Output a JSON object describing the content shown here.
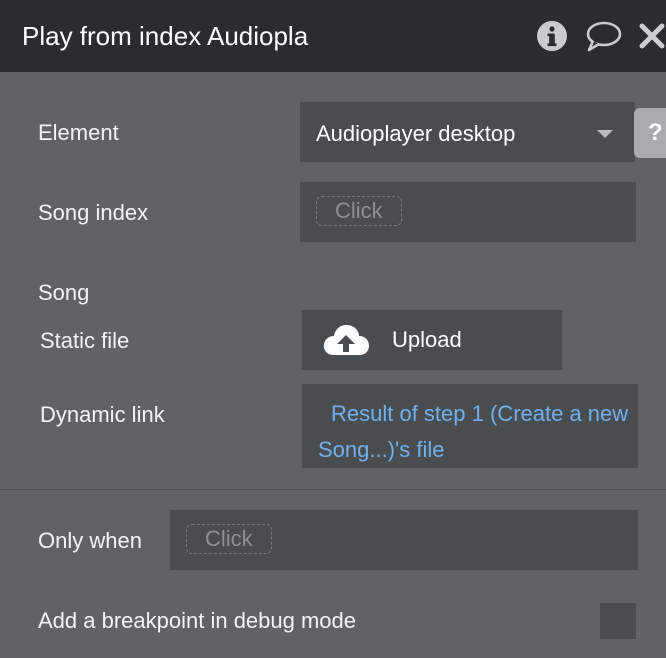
{
  "header": {
    "title": "Play from index Audiopla",
    "icons": [
      "info-icon",
      "comment-icon",
      "close-icon"
    ]
  },
  "form": {
    "element": {
      "label": "Element",
      "value": "Audioplayer desktop",
      "help": "?"
    },
    "song_index": {
      "label": "Song index",
      "placeholder": "Click"
    },
    "song": {
      "label": "Song",
      "static_file": {
        "label": "Static file",
        "button": "Upload",
        "icon": "cloud-upload-icon"
      },
      "dynamic_link": {
        "label": "Dynamic link",
        "value": "Result of step 1 (Create a new Song...)'s file"
      }
    },
    "only_when": {
      "label": "Only when",
      "placeholder": "Click"
    },
    "breakpoint": {
      "label": "Add a breakpoint in debug mode",
      "checked": false
    }
  },
  "colors": {
    "header_bg": "#2a2d30",
    "panel_bg": "#5f6367",
    "field_bg": "#4a4d50",
    "link": "#6fb0ee"
  }
}
